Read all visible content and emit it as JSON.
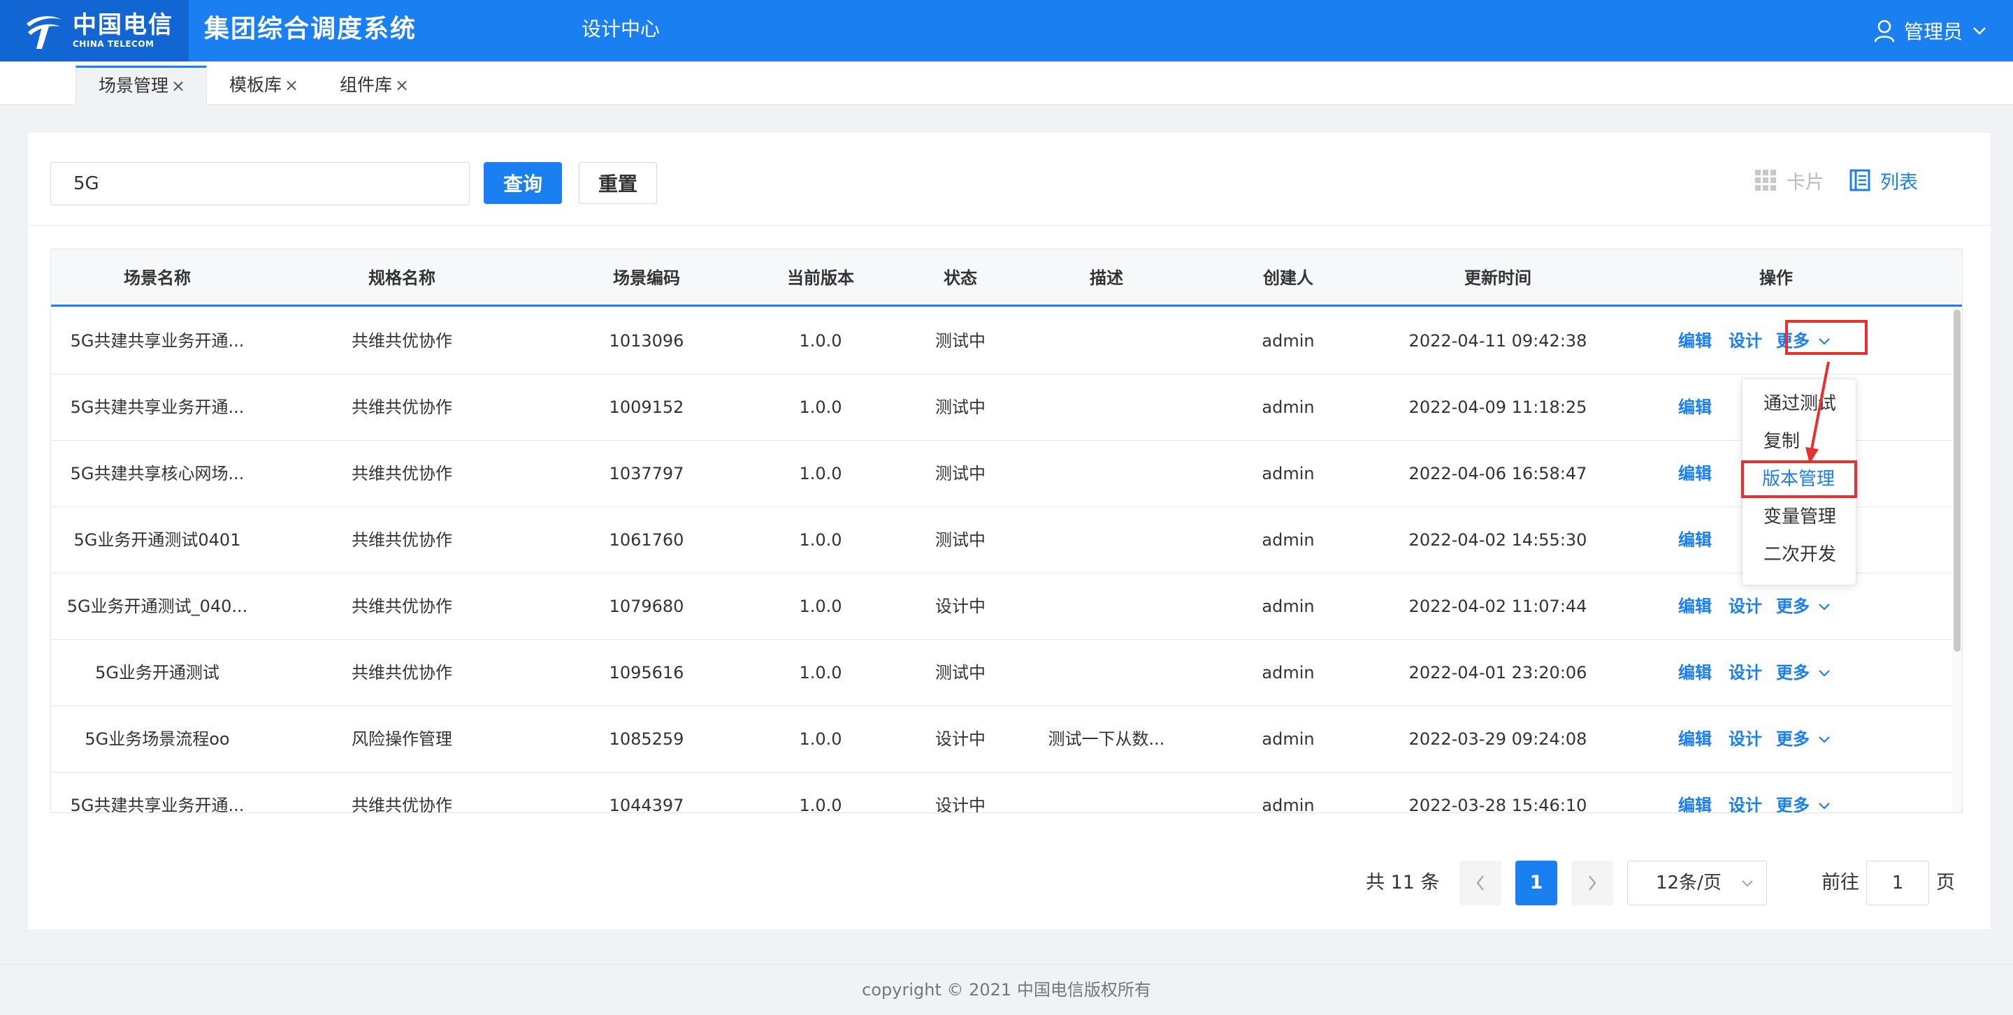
{
  "header": {
    "logo_cn": "中国电信",
    "logo_en": "CHINA TELECOM",
    "app_title": "集团综合调度系统",
    "nav_item": "设计中心",
    "user_name": "管理员",
    "brand_color": "#1a7ff0"
  },
  "tabs": [
    {
      "label": "场景管理",
      "close": "×"
    },
    {
      "label": "模板库",
      "close": "×"
    },
    {
      "label": "组件库",
      "close": "×"
    }
  ],
  "search": {
    "value": "5G",
    "query_label": "查询",
    "reset_label": "重置"
  },
  "view": {
    "card_label": "卡片",
    "list_label": "列表"
  },
  "table": {
    "columns": [
      "场景名称",
      "规格名称",
      "场景编码",
      "当前版本",
      "状态",
      "描述",
      "创建人",
      "更新时间",
      "操作"
    ],
    "rows": [
      {
        "name": "5G共建共享业务开通...",
        "spec": "共维共优协作",
        "code": "1013096",
        "version": "1.0.0",
        "status": "测试中",
        "desc": "",
        "creator": "admin",
        "updated": "2022-04-11 09:42:38"
      },
      {
        "name": "5G共建共享业务开通...",
        "spec": "共维共优协作",
        "code": "1009152",
        "version": "1.0.0",
        "status": "测试中",
        "desc": "",
        "creator": "admin",
        "updated": "2022-04-09 11:18:25"
      },
      {
        "name": "5G共建共享核心网场...",
        "spec": "共维共优协作",
        "code": "1037797",
        "version": "1.0.0",
        "status": "测试中",
        "desc": "",
        "creator": "admin",
        "updated": "2022-04-06 16:58:47"
      },
      {
        "name": "5G业务开通测试0401",
        "spec": "共维共优协作",
        "code": "1061760",
        "version": "1.0.0",
        "status": "测试中",
        "desc": "",
        "creator": "admin",
        "updated": "2022-04-02 14:55:30"
      },
      {
        "name": "5G业务开通测试_040...",
        "spec": "共维共优协作",
        "code": "1079680",
        "version": "1.0.0",
        "status": "设计中",
        "desc": "",
        "creator": "admin",
        "updated": "2022-04-02 11:07:44"
      },
      {
        "name": "5G业务开通测试",
        "spec": "共维共优协作",
        "code": "1095616",
        "version": "1.0.0",
        "status": "测试中",
        "desc": "",
        "creator": "admin",
        "updated": "2022-04-01 23:20:06"
      },
      {
        "name": "5G业务场景流程oo",
        "spec": "风险操作管理",
        "code": "1085259",
        "version": "1.0.0",
        "status": "设计中",
        "desc": "测试一下从数...",
        "creator": "admin",
        "updated": "2022-03-29 09:24:08"
      },
      {
        "name": "5G共建共享业务开通...",
        "spec": "共维共优协作",
        "code": "1044397",
        "version": "1.0.0",
        "status": "设计中",
        "desc": "",
        "creator": "admin",
        "updated": "2022-03-28 15:46:10"
      }
    ],
    "actions": {
      "edit": "编辑",
      "design": "设计",
      "more": "更多"
    }
  },
  "dropdown": {
    "items": [
      "通过测试",
      "复制",
      "版本管理",
      "变量管理",
      "二次开发"
    ],
    "highlighted": "版本管理",
    "highlight_color": "#e8312f"
  },
  "pagination": {
    "total": "共 11 条",
    "current": "1",
    "page_size": "12条/页",
    "goto_label": "前往",
    "goto_value": "1",
    "page_suffix": "页"
  },
  "footer": {
    "copyright": "copyright © 2021 中国电信版权所有"
  }
}
